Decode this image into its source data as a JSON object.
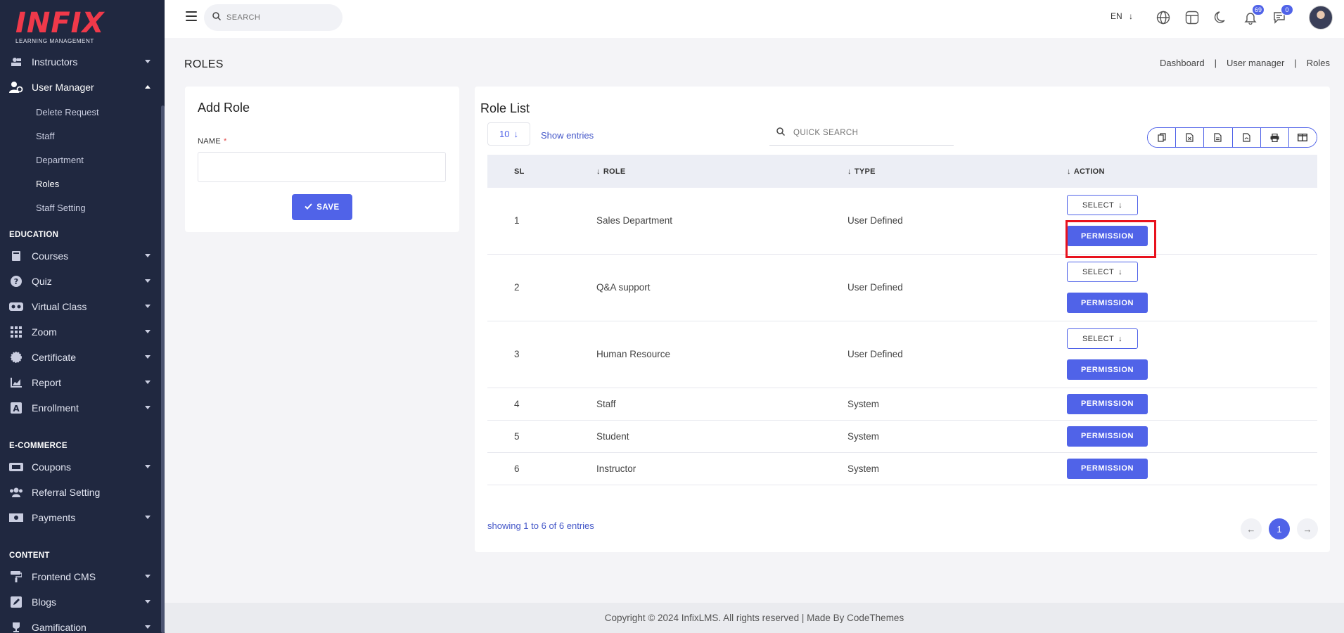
{
  "brand": {
    "name": "INFIX",
    "tagline": "LEARNING MANAGEMENT",
    "accent": "#5063e8",
    "logo_color": "#f0394a",
    "sidebar_bg": "#202840"
  },
  "sidebar": {
    "items_top": [
      {
        "label": "Instructors",
        "icon": "instructor-icon"
      },
      {
        "label": "User Manager",
        "icon": "user-manager-icon",
        "expanded": true
      }
    ],
    "user_manager_sub": [
      "Delete Request",
      "Staff",
      "Department",
      "Roles",
      "Staff Setting"
    ],
    "sections": [
      {
        "title": "EDUCATION",
        "items": [
          {
            "label": "Courses",
            "icon": "book-icon"
          },
          {
            "label": "Quiz",
            "icon": "question-icon"
          },
          {
            "label": "Virtual Class",
            "icon": "vr-icon"
          },
          {
            "label": "Zoom",
            "icon": "grid-icon"
          },
          {
            "label": "Certificate",
            "icon": "certificate-icon"
          },
          {
            "label": "Report",
            "icon": "chart-icon"
          },
          {
            "label": "Enrollment",
            "icon": "enrollment-icon"
          }
        ]
      },
      {
        "title": "E-COMMERCE",
        "items": [
          {
            "label": "Coupons",
            "icon": "coupon-icon"
          },
          {
            "label": "Referral Setting",
            "icon": "users-icon"
          },
          {
            "label": "Payments",
            "icon": "money-icon"
          }
        ]
      },
      {
        "title": "CONTENT",
        "items": [
          {
            "label": "Frontend CMS",
            "icon": "paint-roller-icon"
          },
          {
            "label": "Blogs",
            "icon": "pencil-icon"
          },
          {
            "label": "Gamification",
            "icon": "trophy-icon"
          }
        ]
      }
    ]
  },
  "topbar": {
    "search_placeholder": "SEARCH",
    "language": "EN",
    "notifications_count": "69",
    "messages_count": "0"
  },
  "page": {
    "title": "ROLES",
    "breadcrumb": [
      "Dashboard",
      "User manager",
      "Roles"
    ]
  },
  "add_role": {
    "title": "Add Role",
    "name_label": "NAME",
    "required_mark": "*",
    "save_label": "SAVE"
  },
  "role_list": {
    "title": "Role List",
    "entries_value": "10",
    "show_entries_label": "Show entries",
    "quick_search_placeholder": "QUICK SEARCH",
    "columns": {
      "sl": "SL",
      "role": "ROLE",
      "type": "TYPE",
      "action": "ACTION"
    },
    "select_label": "SELECT",
    "permission_label": "PERMISSION",
    "rows": [
      {
        "sl": "1",
        "role": "Sales Department",
        "type": "User Defined",
        "has_select": true
      },
      {
        "sl": "2",
        "role": "Q&A support",
        "type": "User Defined",
        "has_select": true
      },
      {
        "sl": "3",
        "role": "Human Resource",
        "type": "User Defined",
        "has_select": true
      },
      {
        "sl": "4",
        "role": "Staff",
        "type": "System",
        "has_select": false
      },
      {
        "sl": "5",
        "role": "Student",
        "type": "System",
        "has_select": false
      },
      {
        "sl": "6",
        "role": "Instructor",
        "type": "System",
        "has_select": false
      }
    ],
    "showing_text": "showing 1 to 6 of 6 entries",
    "current_page": "1"
  },
  "footer": {
    "text": "Copyright © 2024 InfixLMS. All rights reserved | Made By CodeThemes"
  }
}
